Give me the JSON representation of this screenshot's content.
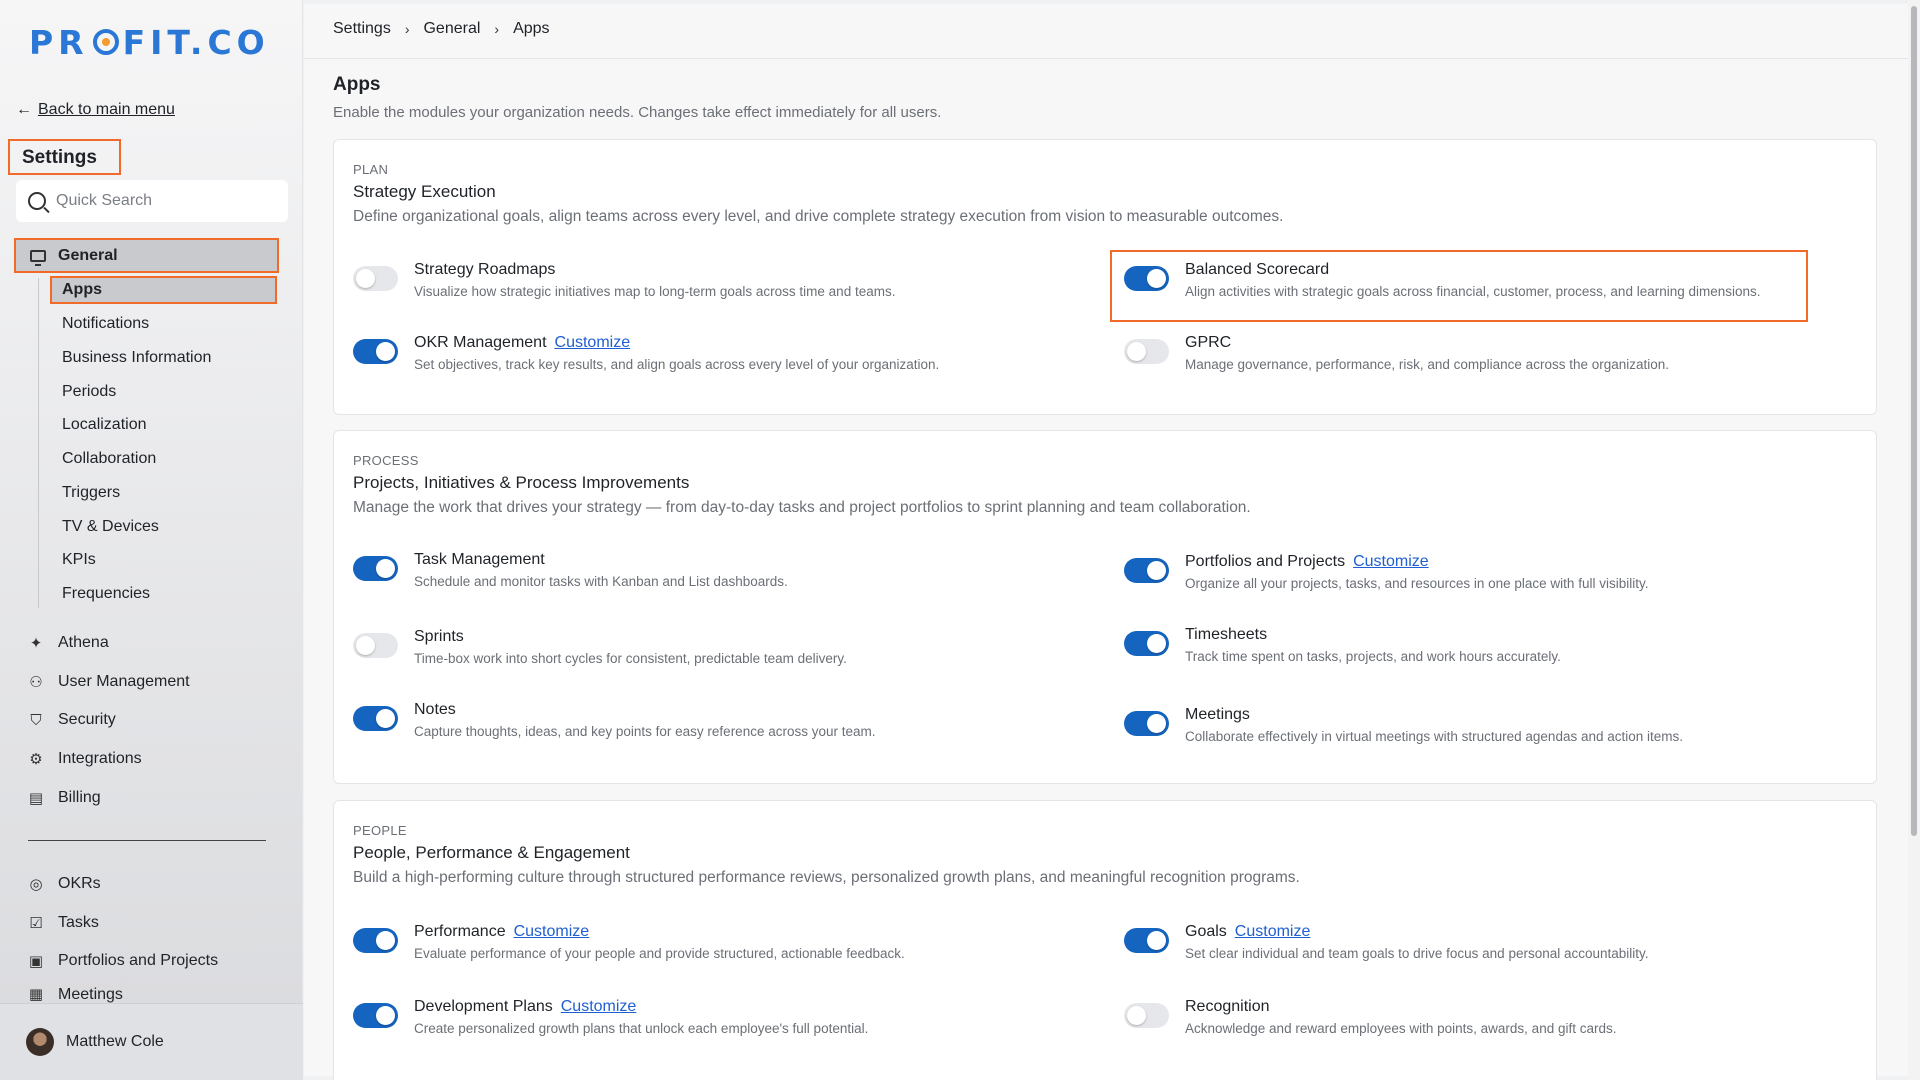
{
  "brand": {
    "logo_text": "PROFIT.CO",
    "logo_pre": "PR",
    "logo_post": "FIT.CO"
  },
  "sidebar": {
    "back_label": "Back to main menu",
    "section_title": "Settings",
    "search_placeholder": "Quick Search",
    "general_label": "General",
    "general_children": [
      "Apps",
      "Notifications",
      "Business Information",
      "Periods",
      "Localization",
      "Collaboration",
      "Triggers",
      "TV & Devices",
      "KPIs",
      "Frequencies"
    ],
    "main_items": [
      {
        "label": "Athena",
        "icon": "sparkle-icon"
      },
      {
        "label": "User Management",
        "icon": "user-icon"
      },
      {
        "label": "Security",
        "icon": "shield-icon"
      },
      {
        "label": "Integrations",
        "icon": "gear-icon"
      },
      {
        "label": "Billing",
        "icon": "receipt-icon"
      }
    ],
    "module_items": [
      {
        "label": "OKRs",
        "icon": "target-icon"
      },
      {
        "label": "Tasks",
        "icon": "clipboard-icon"
      },
      {
        "label": "Portfolios and Projects",
        "icon": "briefcase-icon"
      },
      {
        "label": "Meetings",
        "icon": "calendar-icon"
      }
    ],
    "user_name": "Matthew Cole"
  },
  "breadcrumb": [
    "Settings",
    "General",
    "Apps"
  ],
  "page": {
    "title": "Apps",
    "subtitle": "Enable the modules your organization needs. Changes take effect immediately for all users."
  },
  "sections": [
    {
      "overline": "PLAN",
      "title": "Strategy Execution",
      "description": "Define organizational goals, align teams across every level, and drive complete strategy execution from vision to measurable outcomes.",
      "apps": [
        {
          "name": "Strategy Roadmaps",
          "desc": "Visualize how strategic initiatives map to long-term goals across time and teams.",
          "enabled": false,
          "customize": ""
        },
        {
          "name": "Balanced Scorecard",
          "desc": "Align activities with strategic goals across financial, customer, process, and learning dimensions.",
          "enabled": true,
          "customize": ""
        },
        {
          "name": "OKR Management",
          "desc": "Set objectives, track key results, and align goals across every level of your organization.",
          "enabled": true,
          "customize": "Customize"
        },
        {
          "name": "GPRC",
          "desc": "Manage governance, performance, risk, and compliance across the organization.",
          "enabled": false,
          "customize": ""
        }
      ]
    },
    {
      "overline": "PROCESS",
      "title": "Projects, Initiatives & Process Improvements",
      "description": "Manage the work that drives your strategy — from day-to-day tasks and project portfolios to sprint planning and team collaboration.",
      "apps": [
        {
          "name": "Task Management",
          "desc": "Schedule and monitor tasks with Kanban and List dashboards.",
          "enabled": true,
          "customize": ""
        },
        {
          "name": "Portfolios and Projects",
          "desc": "Organize all your projects, tasks, and resources in one place with full visibility.",
          "enabled": true,
          "customize": "Customize"
        },
        {
          "name": "Sprints",
          "desc": "Time-box work into short cycles for consistent, predictable team delivery.",
          "enabled": false,
          "customize": ""
        },
        {
          "name": "Timesheets",
          "desc": "Track time spent on tasks, projects, and work hours accurately.",
          "enabled": true,
          "customize": ""
        },
        {
          "name": "Notes",
          "desc": "Capture thoughts, ideas, and key points for easy reference across your team.",
          "enabled": true,
          "customize": ""
        },
        {
          "name": "Meetings",
          "desc": "Collaborate effectively in virtual meetings with structured agendas and action items.",
          "enabled": true,
          "customize": ""
        }
      ]
    },
    {
      "overline": "PEOPLE",
      "title": "People, Performance & Engagement",
      "description": "Build a high-performing culture through structured performance reviews, personalized growth plans, and meaningful recognition programs.",
      "apps": [
        {
          "name": "Performance",
          "desc": "Evaluate performance of your people and provide structured, actionable feedback.",
          "enabled": true,
          "customize": "Customize"
        },
        {
          "name": "Goals",
          "desc": "Set clear individual and team goals to drive focus and personal accountability.",
          "enabled": true,
          "customize": "Customize"
        },
        {
          "name": "Development Plans",
          "desc": "Create personalized growth plans that unlock each employee's full potential.",
          "enabled": true,
          "customize": "Customize"
        },
        {
          "name": "Recognition",
          "desc": "Acknowledge and reward employees with points, awards, and gift cards.",
          "enabled": false,
          "customize": ""
        }
      ]
    }
  ],
  "colors": {
    "accent": "#1565c0",
    "highlight": "#f06a2a",
    "link": "#1f5fd1"
  }
}
